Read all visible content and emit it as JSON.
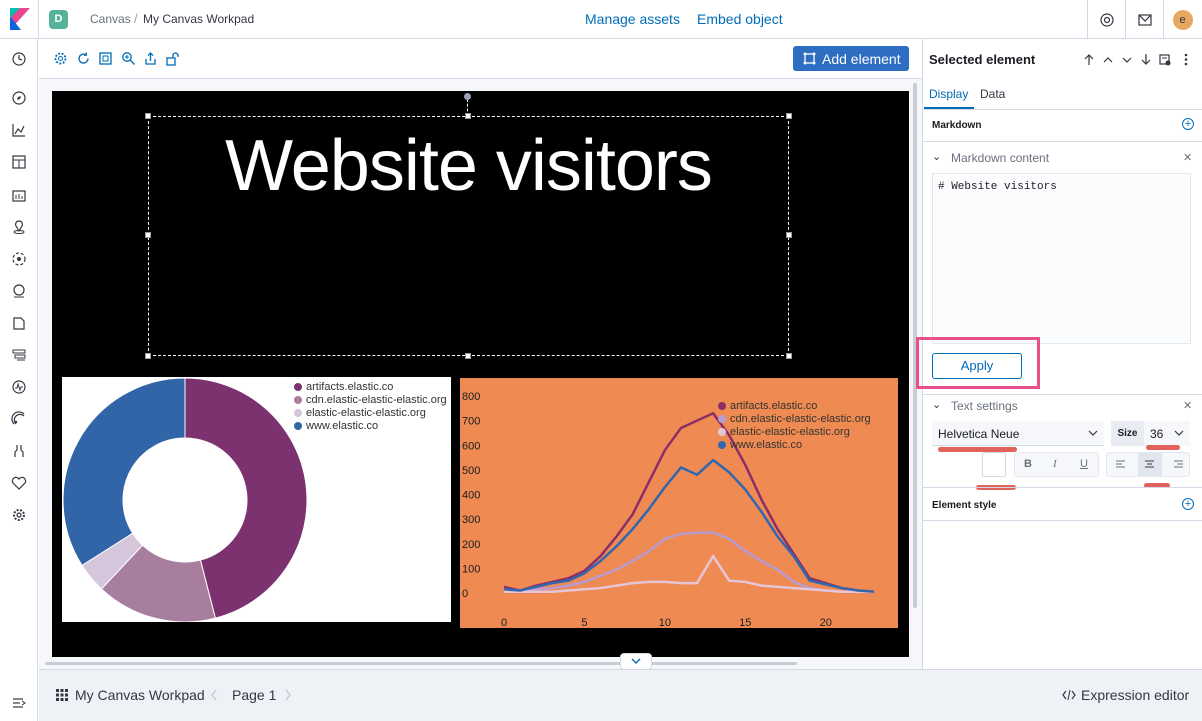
{
  "header": {
    "space_badge": "D",
    "breadcrumbs": [
      "Canvas",
      "My Canvas Workpad"
    ],
    "breadcrumb_separator": "/",
    "avatar_initial": "e"
  },
  "toolbar": {
    "manage_assets": "Manage assets",
    "embed_object": "Embed object",
    "add_element": "Add element"
  },
  "workpad": {
    "title_text": "Website visitors",
    "pie_chart": {
      "type": "pie",
      "legend": [
        "artifacts.elastic.co",
        "cdn.elastic-elastic-elastic.org",
        "elastic-elastic-elastic.org",
        "www.elastic.co"
      ],
      "values": [
        46,
        16,
        4,
        34
      ],
      "colors": [
        "#7d3270",
        "#a87e9f",
        "#d5c6db",
        "#3165a8"
      ]
    },
    "line_chart": {
      "type": "line",
      "legend": [
        "artifacts.elastic.co",
        "cdn.elastic-elastic-elastic.org",
        "elastic-elastic-elastic.org",
        "www.elastic.co"
      ],
      "y_ticks": [
        "800",
        "700",
        "600",
        "500",
        "400",
        "300",
        "200",
        "100",
        "0"
      ],
      "x_ticks": [
        "0",
        "5",
        "10",
        "15",
        "20"
      ]
    }
  },
  "chart_data": [
    {
      "type": "pie",
      "categories": [
        "artifacts.elastic.co",
        "cdn.elastic-elastic-elastic.org",
        "elastic-elastic-elastic.org",
        "www.elastic.co"
      ],
      "values": [
        46,
        16,
        4,
        34
      ],
      "legend": "top-right"
    },
    {
      "type": "line",
      "x": [
        0,
        1,
        2,
        3,
        4,
        5,
        6,
        7,
        8,
        9,
        10,
        11,
        12,
        13,
        14,
        15,
        16,
        17,
        18,
        19,
        20,
        21,
        22,
        23
      ],
      "series": [
        {
          "name": "artifacts.elastic.co",
          "color": "#8b2e67",
          "values": [
            25,
            10,
            30,
            45,
            60,
            90,
            150,
            230,
            320,
            450,
            580,
            670,
            700,
            730,
            640,
            520,
            380,
            260,
            160,
            60,
            40,
            20,
            10,
            5
          ]
        },
        {
          "name": "cdn.elastic-elastic-elastic.org",
          "color": "#b79bd1",
          "values": [
            10,
            5,
            15,
            20,
            30,
            45,
            70,
            95,
            130,
            170,
            220,
            240,
            245,
            245,
            220,
            170,
            130,
            95,
            45,
            20,
            10,
            5,
            5,
            5
          ]
        },
        {
          "name": "elastic-elastic-elastic.org",
          "color": "#e6c6d6",
          "values": [
            5,
            5,
            5,
            5,
            10,
            15,
            20,
            30,
            40,
            45,
            45,
            40,
            40,
            150,
            50,
            45,
            30,
            25,
            20,
            15,
            10,
            5,
            5,
            5
          ]
        },
        {
          "name": "www.elastic.co",
          "color": "#3367ad",
          "values": [
            15,
            10,
            25,
            40,
            50,
            80,
            130,
            190,
            260,
            340,
            430,
            510,
            480,
            540,
            490,
            420,
            330,
            230,
            150,
            50,
            35,
            20,
            10,
            5
          ]
        }
      ],
      "ylim": [
        0,
        800
      ],
      "xlim": [
        0,
        23
      ],
      "legend": "top-right"
    }
  ],
  "sidebar": {
    "title": "Selected element",
    "tabs": [
      "Display",
      "Data"
    ],
    "markdown_section": "Markdown",
    "markdown_content_label": "Markdown content",
    "markdown_value": "# Website visitors",
    "apply_label": "Apply",
    "text_settings_label": "Text settings",
    "font_family": "Helvetica Neue",
    "size_label": "Size",
    "size_value": "36",
    "element_style_label": "Element style"
  },
  "footer": {
    "workpad_name": "My Canvas Workpad",
    "page_label": "Page 1",
    "expression_editor": "Expression editor"
  },
  "colors": {
    "accent": "#006bb8",
    "primary_button": "#2e6ec2",
    "highlight": "#e7508a",
    "line_chart_bg": "#ef8b52"
  }
}
